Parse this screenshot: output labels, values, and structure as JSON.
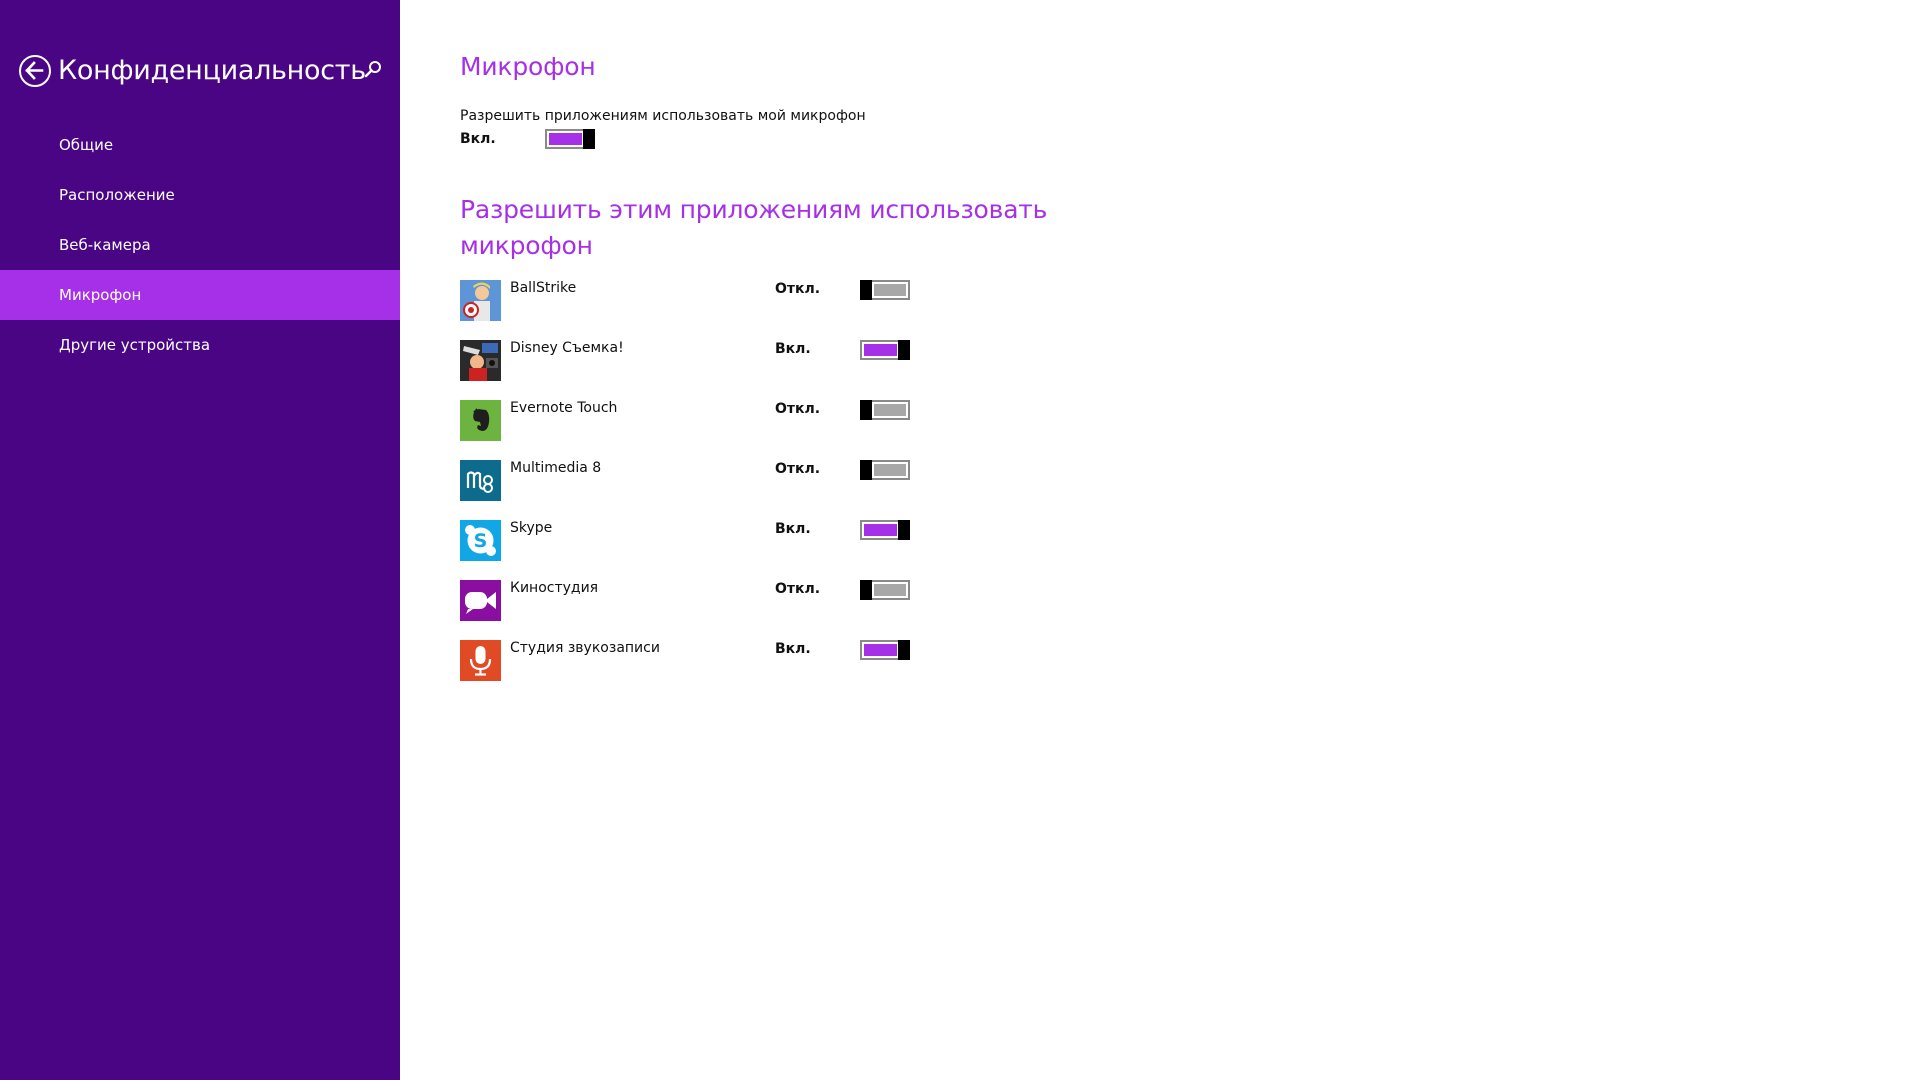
{
  "sidebar": {
    "title": "Конфиденциальность",
    "items": [
      {
        "label": "Общие",
        "active": false
      },
      {
        "label": "Расположение",
        "active": false
      },
      {
        "label": "Веб-камера",
        "active": false
      },
      {
        "label": "Микрофон",
        "active": true
      },
      {
        "label": "Другие устройства",
        "active": false
      }
    ]
  },
  "main": {
    "title": "Микрофон",
    "description": "Разрешить приложениям использовать мой микрофон",
    "state_label": "Вкл.",
    "state_on": true,
    "apps_heading": "Разрешить этим приложениям использовать микрофон",
    "apps": [
      {
        "name": "BallStrike",
        "state": "Откл.",
        "on": false,
        "icon": "ballstrike-icon",
        "color": "#3a7ac8"
      },
      {
        "name": "Disney Съемка!",
        "state": "Вкл.",
        "on": true,
        "icon": "disney-icon",
        "color": "#2a2a2a"
      },
      {
        "name": "Evernote Touch",
        "state": "Откл.",
        "on": false,
        "icon": "evernote-icon",
        "color": "#6db33f"
      },
      {
        "name": "Multimedia 8",
        "state": "Откл.",
        "on": false,
        "icon": "multimedia-icon",
        "color": "#0d6b8e"
      },
      {
        "name": "Skype",
        "state": "Вкл.",
        "on": true,
        "icon": "skype-icon",
        "color": "#11a7e6"
      },
      {
        "name": "Киностудия",
        "state": "Откл.",
        "on": false,
        "icon": "movie-camera-icon",
        "color": "#8a0ea0"
      },
      {
        "name": "Студия звукозаписи",
        "state": "Вкл.",
        "on": true,
        "icon": "microphone-icon",
        "color": "#e04a24"
      }
    ]
  },
  "colors": {
    "sidebar_bg": "#4a0584",
    "accent": "#a530e8",
    "toggle_off": "#a8a8a8"
  }
}
